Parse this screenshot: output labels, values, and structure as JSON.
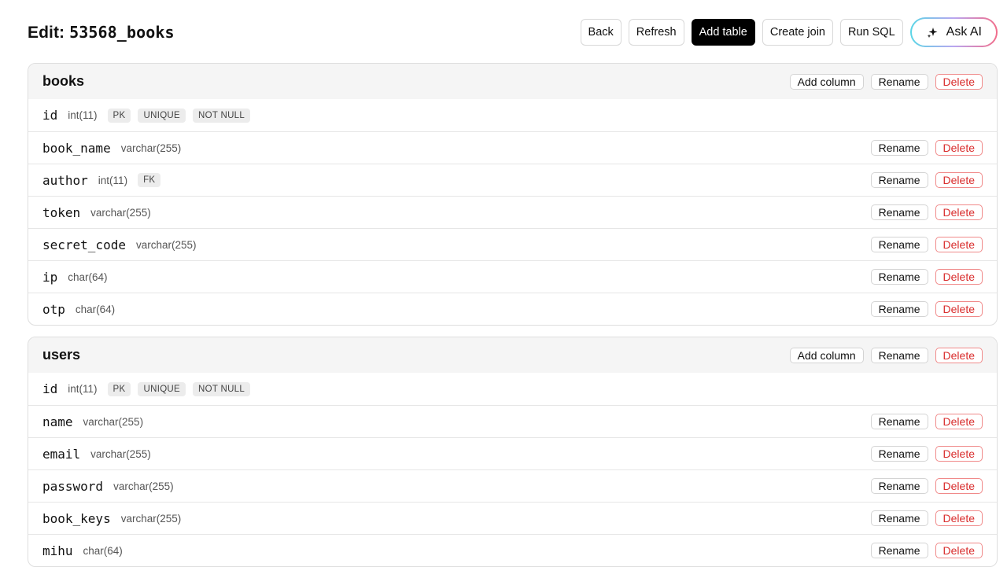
{
  "header": {
    "title_prefix": "Edit: ",
    "title_name": "53568_books",
    "buttons": {
      "back": "Back",
      "refresh": "Refresh",
      "add_table": "Add table",
      "create_join": "Create join",
      "run_sql": "Run SQL",
      "ask_ai": "Ask AI"
    }
  },
  "labels": {
    "add_column": "Add column",
    "rename": "Rename",
    "delete": "Delete"
  },
  "colors": {
    "primary_button": "#000000",
    "danger": "#d92d2d"
  },
  "tables": [
    {
      "name": "books",
      "columns": [
        {
          "name": "id",
          "type": "int(11)",
          "badges": [
            "PK",
            "UNIQUE",
            "NOT NULL"
          ]
        },
        {
          "name": "book_name",
          "type": "varchar(255)",
          "badges": []
        },
        {
          "name": "author",
          "type": "int(11)",
          "badges": [
            "FK"
          ]
        },
        {
          "name": "token",
          "type": "varchar(255)",
          "badges": []
        },
        {
          "name": "secret_code",
          "type": "varchar(255)",
          "badges": []
        },
        {
          "name": "ip",
          "type": "char(64)",
          "badges": []
        },
        {
          "name": "otp",
          "type": "char(64)",
          "badges": []
        }
      ]
    },
    {
      "name": "users",
      "columns": [
        {
          "name": "id",
          "type": "int(11)",
          "badges": [
            "PK",
            "UNIQUE",
            "NOT NULL"
          ]
        },
        {
          "name": "name",
          "type": "varchar(255)",
          "badges": []
        },
        {
          "name": "email",
          "type": "varchar(255)",
          "badges": []
        },
        {
          "name": "password",
          "type": "varchar(255)",
          "badges": []
        },
        {
          "name": "book_keys",
          "type": "varchar(255)",
          "badges": []
        },
        {
          "name": "mihu",
          "type": "char(64)",
          "badges": []
        }
      ]
    }
  ]
}
